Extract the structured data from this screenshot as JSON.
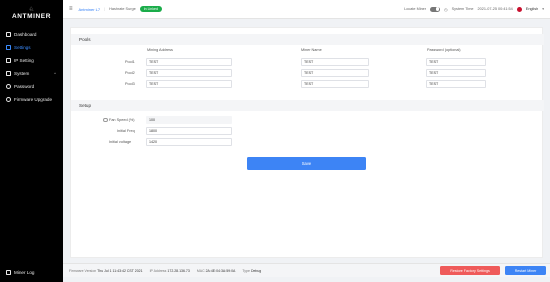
{
  "brand": {
    "logo_text": "ANTMINER"
  },
  "sidebar": {
    "items": [
      {
        "label": "Dashboard",
        "icon": "dashboard-icon"
      },
      {
        "label": "Settings",
        "icon": "settings-icon",
        "active": true
      },
      {
        "label": "IP Setting",
        "icon": "ip-setting-icon"
      },
      {
        "label": "System",
        "icon": "system-icon",
        "chevron": "^"
      },
      {
        "label": "Password",
        "icon": "password-icon"
      },
      {
        "label": "Firmware Upgrade",
        "icon": "firmware-upgrade-icon"
      }
    ],
    "bottom": {
      "label": "Miner Log",
      "icon": "miner-log-icon"
    }
  },
  "header": {
    "menu_icon": "≡",
    "model": "Antminer L7",
    "hashrate_label": "Hashrate Surge",
    "status": "In Linked",
    "locate_miner_label": "Locate Miner",
    "system_time_label": "System Time",
    "system_time_value": "2021-07-25 00:41:54",
    "language": "English"
  },
  "pools": {
    "title": "Pools",
    "columns": [
      "Mining Address",
      "Miner Name",
      "Password (optional)"
    ],
    "rows": [
      {
        "label": "Pool1",
        "address": "TEST",
        "miner": "TEST",
        "password": "TEST"
      },
      {
        "label": "Pool2",
        "address": "TEST",
        "miner": "TEST",
        "password": "TEST"
      },
      {
        "label": "Pool3",
        "address": "TEST",
        "miner": "TEST",
        "password": "TEST"
      }
    ]
  },
  "setup": {
    "title": "Setup",
    "fan_speed_label": "Fan Speed (%)",
    "fan_speed_value": "100",
    "initial_freq_label": "Initial Freq",
    "initial_freq_value": "1800",
    "initial_voltage_label": "Initial voltage",
    "initial_voltage_value": "1420"
  },
  "save_button": "Save",
  "footer": {
    "firmware_label": "Firmware Version",
    "firmware_value": "Thu Jul 1 11:43:42 CST 2021",
    "ip_label": "IP Address",
    "ip_value": "172.28.136.73",
    "mac_label": "MAC",
    "mac_value": "2A:4E:04:3A:59:0A",
    "type_label": "Type",
    "type_value": "Debug",
    "restore_button": "Restore Factory Settings",
    "restart_button": "Restart Miner"
  },
  "colors": {
    "accent": "#3d84f5",
    "status_green": "#1aac4a",
    "danger": "#ef5a5a",
    "sidebar_bg": "#000000"
  }
}
